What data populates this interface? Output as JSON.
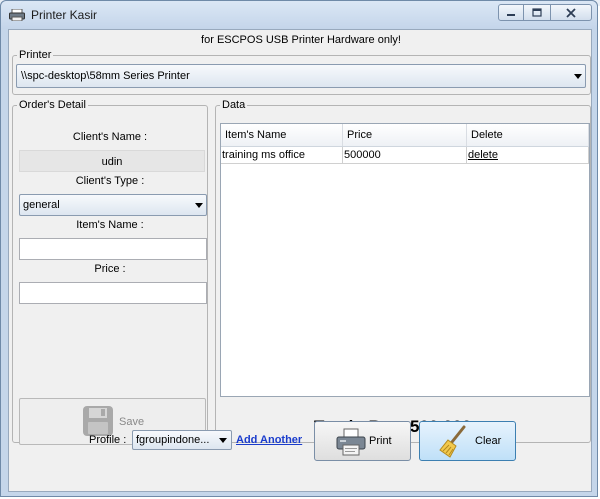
{
  "window": {
    "title": "Printer Kasir",
    "icon": "printer-icon"
  },
  "notice": "for ESCPOS USB Printer Hardware only!",
  "printer": {
    "legend": "Printer",
    "selected": "\\\\spc-desktop\\58mm Series Printer"
  },
  "order": {
    "legend": "Order's Detail",
    "client_name_label": "Client's Name :",
    "client_name_value": "udin",
    "client_type_label": "Client's Type :",
    "client_type_selected": "general",
    "item_name_label": "Item's Name :",
    "item_name_value": "",
    "price_label": "Price :",
    "price_value": "",
    "save_label": "Save"
  },
  "data": {
    "legend": "Data",
    "columns": [
      "Item's Name",
      "Price",
      "Delete"
    ],
    "rows": [
      {
        "item": "training ms office",
        "price": "500000",
        "delete": "delete"
      }
    ]
  },
  "total": {
    "label": "Total : Rp.",
    "value": "500.000"
  },
  "footer": {
    "profile_label": "Profile :",
    "profile_selected": "fgroupindone...",
    "add_another": "Add Another",
    "print_label": "Print",
    "clear_label": "Clear"
  },
  "colors": {
    "link": "#1a3ccc",
    "window_frame": "#c5d6ea",
    "clear_button": "#bfe0f8"
  }
}
